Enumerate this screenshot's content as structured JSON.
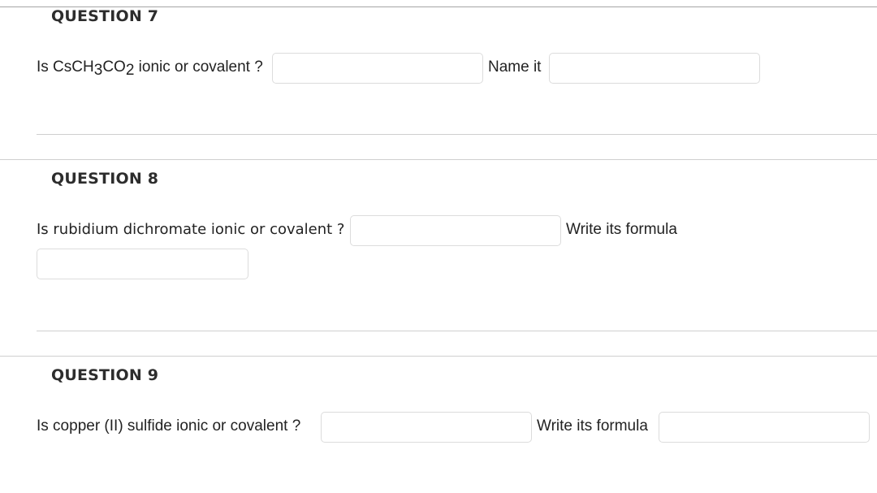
{
  "questions": [
    {
      "title": "QUESTION 7",
      "prompt_prefix": "Is CsCH",
      "prompt_sub1": "3",
      "prompt_mid": "CO",
      "prompt_sub2": "2",
      "prompt_suffix": " ionic or covalent ?",
      "answer1_value": "",
      "second_label": "Name it",
      "answer2_value": ""
    },
    {
      "title": "QUESTION 8",
      "prompt": "Is rubidium dichromate ionic or covalent ?",
      "answer1_value": "",
      "second_label": "Write its formula",
      "answer2_value": ""
    },
    {
      "title": "QUESTION 9",
      "prompt": "Is copper (II) sulfide ionic or covalent ?",
      "answer1_value": "",
      "second_label": "Write its formula",
      "answer2_value": ""
    }
  ]
}
